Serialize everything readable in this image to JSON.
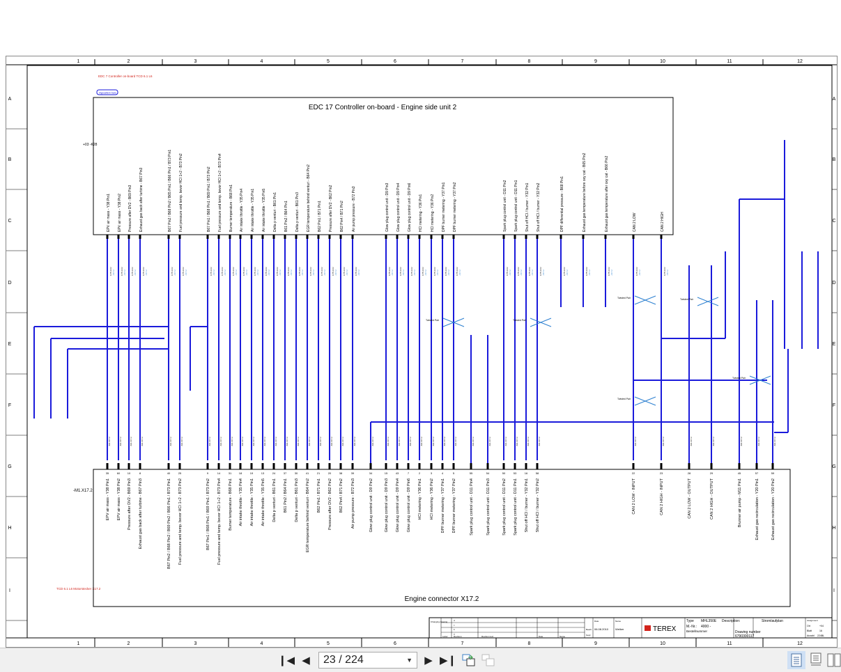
{
  "viewer": {
    "page_indicator": "23 / 224",
    "buttons": {
      "first": "first-page",
      "prev": "previous-page",
      "next": "next-page",
      "last": "last-page",
      "link1": "sync-pages",
      "link2": "unsync-pages"
    }
  },
  "sheet": {
    "column_numbers": [
      "1",
      "2",
      "3",
      "4",
      "5",
      "6",
      "7",
      "8",
      "9",
      "10",
      "11",
      "12"
    ],
    "row_letters": [
      "A",
      "B",
      "C",
      "D",
      "E",
      "F",
      "G",
      "H",
      "I"
    ],
    "header_note": "EDC 7 Controller on-board TCD 6.1 L6",
    "footer_note": "TCD 6.1 L6 Motorstecker X17.2",
    "page_ref_badge": "Hypoaltern bars.",
    "controller": {
      "title": "EDC 17 Controller on-board - Engine side unit 2",
      "ref": "+03 -K28",
      "pins": [
        "EPV air mass - Y38 Pin1",
        "EPV air mass - Y38 Pin2",
        "Pressure after DV2 - B69 Pin3",
        "Exhaust gas back after turbine - B67 Pin3",
        "B67 Pin2 / B68 Pin2 / B65 Pin1 / B66 Pin1 / B73 Pin1",
        "Fuel pressure and temp. bevor HCI 1+2 - B73 Pin2",
        "B67 Pin1 / B68 Pin1 / B69 Pin1 / B73 Pin2",
        "Fuel pressure and temp. bevor HCI 1+2 - B73 Pin4",
        "Burner temperature - B68 Pin1",
        "Air intake throttle - Y35 Pin4",
        "Air intake throttle - Y35 Pin1",
        "Air intake throttle - Y35 Pin5",
        "Delta p venturi - B61 Pin1",
        "B61 Pin2 / B64 Pin1",
        "Delta p venturi - B61 Pin3",
        "EGR temperature behind venturi - B64 Pin2",
        "B62 Pin1 / B71 Pin1",
        "Pressure after DV2 - B62 Pin2",
        "B62 Pin4 / B71 Pin2",
        "Air pump pressure - B72 Pin3",
        "Glow plug control unit - D9 Pin3",
        "Glow plug control unit - D9 Pin4",
        "Glow plug control unit - D9 Pin6",
        "HCI metering - Y36 Pin1",
        "HCI metering - Y36 Pin2",
        "DPF burner metering - Y37 Pin1",
        "DPF burner metering - Y37 Pin2",
        "Spark plug control unit - D11 Pin2",
        "Spark plug control unit - D11 Pin1",
        "Shut off HCI / burner - Y32 Pin1",
        "Shut off HCI / burner - Y32 Pin2",
        "DPF differential pressure - B68 Pin1",
        "Exhaust gas temperature before oxy cat - B65 Pin2",
        "Exhaust gas temperature after oxy cat - B66 Pin2",
        "CAN 2 LOW",
        "CAN 2 HIGH"
      ]
    },
    "connector": {
      "title": "Engine connector X17.2",
      "ref": "-M1.X17.2",
      "pins": [
        {
          "n": "35",
          "label": "EPV air mass - Y38 Pin1"
        },
        {
          "n": "60",
          "label": "EPV air mass - Y38 Pin2"
        },
        {
          "n": "10",
          "label": "Pressure after DV2 - B69 Pin3"
        },
        {
          "n": "8",
          "label": "Exhaust gas back after turbine - B67 Pin3"
        },
        {
          "n": "40",
          "label": "B67 Pin2 / B68 Pin2 / B69 Pin2 / B66 Pin1 / B73 Pin1"
        },
        {
          "n": "25",
          "label": "Fuel pressure and temp. bevor HCI 1+2 - B73 Pin2"
        },
        {
          "n": "9",
          "label": "B67 Pin1 / B68 Pin1 / B69 Pin1 / B73 Pin2"
        },
        {
          "n": "14",
          "label": "Fuel pressure and temp. bevor HCI 1+2 - B73 Pin4"
        },
        {
          "n": "31",
          "label": "Burner temperature - B68 Pin1"
        },
        {
          "n": "18",
          "label": "Air intake throttle - Y35 Pin4"
        },
        {
          "n": "19",
          "label": "Air intake throttle - Y35 Pin1"
        },
        {
          "n": "13",
          "label": "Air intake throttle - Y35 Pin5"
        },
        {
          "n": "24",
          "label": "Delta p venturi - B61 Pin1"
        },
        {
          "n": "37",
          "label": "B61 Pin2 / B64 Pin1"
        },
        {
          "n": "30",
          "label": "Delta p venturi - B61 Pin3"
        },
        {
          "n": "41",
          "label": "EGR temperature behind venturi - B64 Pin2"
        },
        {
          "n": "21",
          "label": "B62 Pin1 / B71 Pin1"
        },
        {
          "n": "20",
          "label": "Pressure after DV2 - B62 Pin2"
        },
        {
          "n": "38",
          "label": "B62 Pin4 / B71 Pin2"
        },
        {
          "n": "39",
          "label": "Air pump pressure - B72 Pin3"
        },
        {
          "n": "34",
          "label": "Glow plug control unit - D9 Pin2"
        },
        {
          "n": "15",
          "label": "Glow plug control unit - D9 Pin3"
        },
        {
          "n": "43",
          "label": "Glow plug control unit - D9 Pin4"
        },
        {
          "n": "7",
          "label": "Glow plug control unit - D9 Pin6"
        },
        {
          "n": "2",
          "label": "HCI metering - Y36 Pin1"
        },
        {
          "n": "3",
          "label": "HCI metering - Y36 Pin2"
        },
        {
          "n": "4",
          "label": "DPF burner metering - Y37 Pin1"
        },
        {
          "n": "5",
          "label": "DPF burner metering - Y37 Pin2"
        },
        {
          "n": "55",
          "label": "Spark plug control unit - D11 Pin4"
        },
        {
          "n": "54",
          "label": "Spark plug control unit - D11 Pin3"
        },
        {
          "n": "50",
          "label": "Spark plug control unit - D11 Pin2"
        },
        {
          "n": "53",
          "label": "Spark plug control unit - D11 Pin1"
        },
        {
          "n": "16",
          "label": "Shut off HCI / burner - Y32 Pin1"
        },
        {
          "n": "58",
          "label": "Shut off HCI / burner - Y32 Pin2"
        },
        {
          "n": "22",
          "label": "CAN 2 LOW - INPUT"
        },
        {
          "n": "23",
          "label": "CAN 2 HIGH - INPUT"
        },
        {
          "n": "28",
          "label": "CAN 2 LOW - OUTPUT"
        },
        {
          "n": "29",
          "label": "CAN 2 HIGH - OUTPUT"
        },
        {
          "n": "45",
          "label": "Brunner air pump - M11 Pin1"
        },
        {
          "n": "57",
          "label": "Exhaust gas recirculation - Y20 Pin1"
        },
        {
          "n": "59",
          "label": "Exhaust gas recirculation - Y20 Pin2"
        }
      ]
    },
    "twisted_pair_label": "Twisted Pair",
    "title_block": {
      "changing_label": "Changing drawing only in the CDI",
      "rev_letters": [
        "d",
        "c",
        "b",
        "a"
      ],
      "col_letter": "Letter",
      "col_revision": "Revision",
      "col_revised": "Revision text",
      "col_date": "Date",
      "col_name": "Name",
      "date_label": "Date",
      "name_label": "Name",
      "bearb_label": "Bearb.",
      "bearb_date": "06.08.2010",
      "bearb_name": "Welker",
      "gepr_label": "Gepr.",
      "brand": "TEREX",
      "type_label": "Type",
      "type_value": "MHL350E",
      "mnr_label": "M.-Nr.:",
      "mnr_value": "4000 -",
      "description_label": "Description:",
      "description_value": "Stromlaufplan",
      "order_label": "Bestellnummer",
      "drawing_label": "Drawing number",
      "drawing_value": "6790300117",
      "assign_label": "Assignment",
      "ort_label": "Ort",
      "ort_value": "+04",
      "blatt_label": "Blatt",
      "blatt_value": "16",
      "anzahl_label": "Anzahl",
      "anzahl_value": "224BL"
    },
    "colors": {
      "wire": "#1a1adb",
      "label_blue": "#2b7fd0",
      "green": "#2a9a3a",
      "red": "#d2231b",
      "frame": "#000000"
    }
  }
}
